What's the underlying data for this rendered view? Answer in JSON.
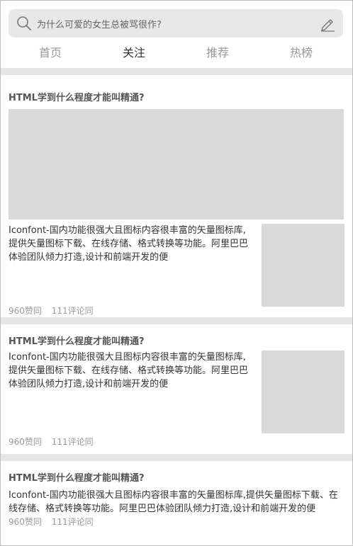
{
  "search": {
    "placeholder": "为什么可爱的女生总被骂很作?"
  },
  "tabs": [
    {
      "label": "首页"
    },
    {
      "label": "关注"
    },
    {
      "label": "推荐"
    },
    {
      "label": "热榜"
    }
  ],
  "cards": [
    {
      "title": "HTML学到什么程度才能叫精通?",
      "text": "Iconfont-国内功能很强大且图标内容很丰富的矢量图标库,提供矢量图标下载、在线存储、格式转换等功能。阿里巴巴体验团队倾力打造,设计和前端开发的便",
      "likes": "960赞同",
      "comments": "111评论同"
    },
    {
      "title": "HTML学到什么程度才能叫精通?",
      "text": "Iconfont-国内功能很强大且图标内容很丰富的矢量图标库,提供矢量图标下载、在线存储、格式转换等功能。阿里巴巴体验团队倾力打造,设计和前端开发的便",
      "likes": "960赞同",
      "comments": "111评论同"
    },
    {
      "title": "HTML学到什么程度才能叫精通?",
      "text": "Iconfont-国内功能很强大且图标内容很丰富的矢量图标库,提供矢量图标下载、在线存储、格式转换等功能。阿里巴巴体验团队倾力打造,设计和前端开发的便",
      "likes": "960赞同",
      "comments": "111评论同"
    }
  ]
}
